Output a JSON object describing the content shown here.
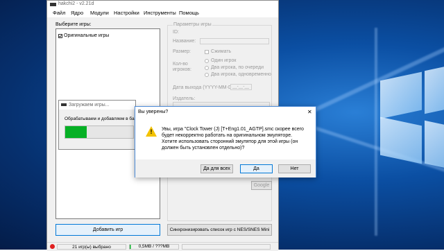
{
  "app": {
    "title": "hakchi2 - v2.21d"
  },
  "menu": [
    "Файл",
    "Ядро",
    "Модули",
    "Настройки",
    "Инструменты",
    "Помощь"
  ],
  "left": {
    "select_label": "Выберите игры:",
    "original_games": "Оригинальные игры",
    "add_games_button": "Добавить игр"
  },
  "params": {
    "title": "Параметры игры",
    "id_label": "ID:",
    "name_label": "Название:",
    "size_label": "Размер:",
    "compress_label": "Сжимать",
    "players_label_1": "Кол-во",
    "players_label_2": "игроков:",
    "one_player": "Один игрок",
    "two_alternate": "Два игрока, по очереди",
    "two_simultaneous": "Два игрока, одновременно",
    "release_label": "Дата выхода (YYYY-MM-DD):",
    "release_mask": "__-__-__",
    "publisher_label": "Издатель:",
    "google_button": "Google",
    "sync_button": "Синхронизировать список игр с NES/SNES Mini"
  },
  "status": {
    "selected": "21 игр(ы) выбрано",
    "size": "0,5MB / ???MB"
  },
  "loading": {
    "title": "Загружаем игры...",
    "text": "Обрабатываем и добавляем в ба",
    "progress": 0.32
  },
  "dialog": {
    "title": "Вы уверены?",
    "message": "Увы, игра \"Clock Tower (J) [T+Eng1.01_AGTP].smc скорее всего будет некорректно работать на оригинальном эмуляторе. Хотите использовать сторонний эмулятор для этой игры (он должен быть установлен отдельно)?",
    "yes_all": "Да для всех",
    "yes": "Да",
    "no": "Нет",
    "close": "✕"
  },
  "colors": {
    "progress": "#06b025",
    "warning": "#f3c200",
    "accent": "#0078d7"
  }
}
